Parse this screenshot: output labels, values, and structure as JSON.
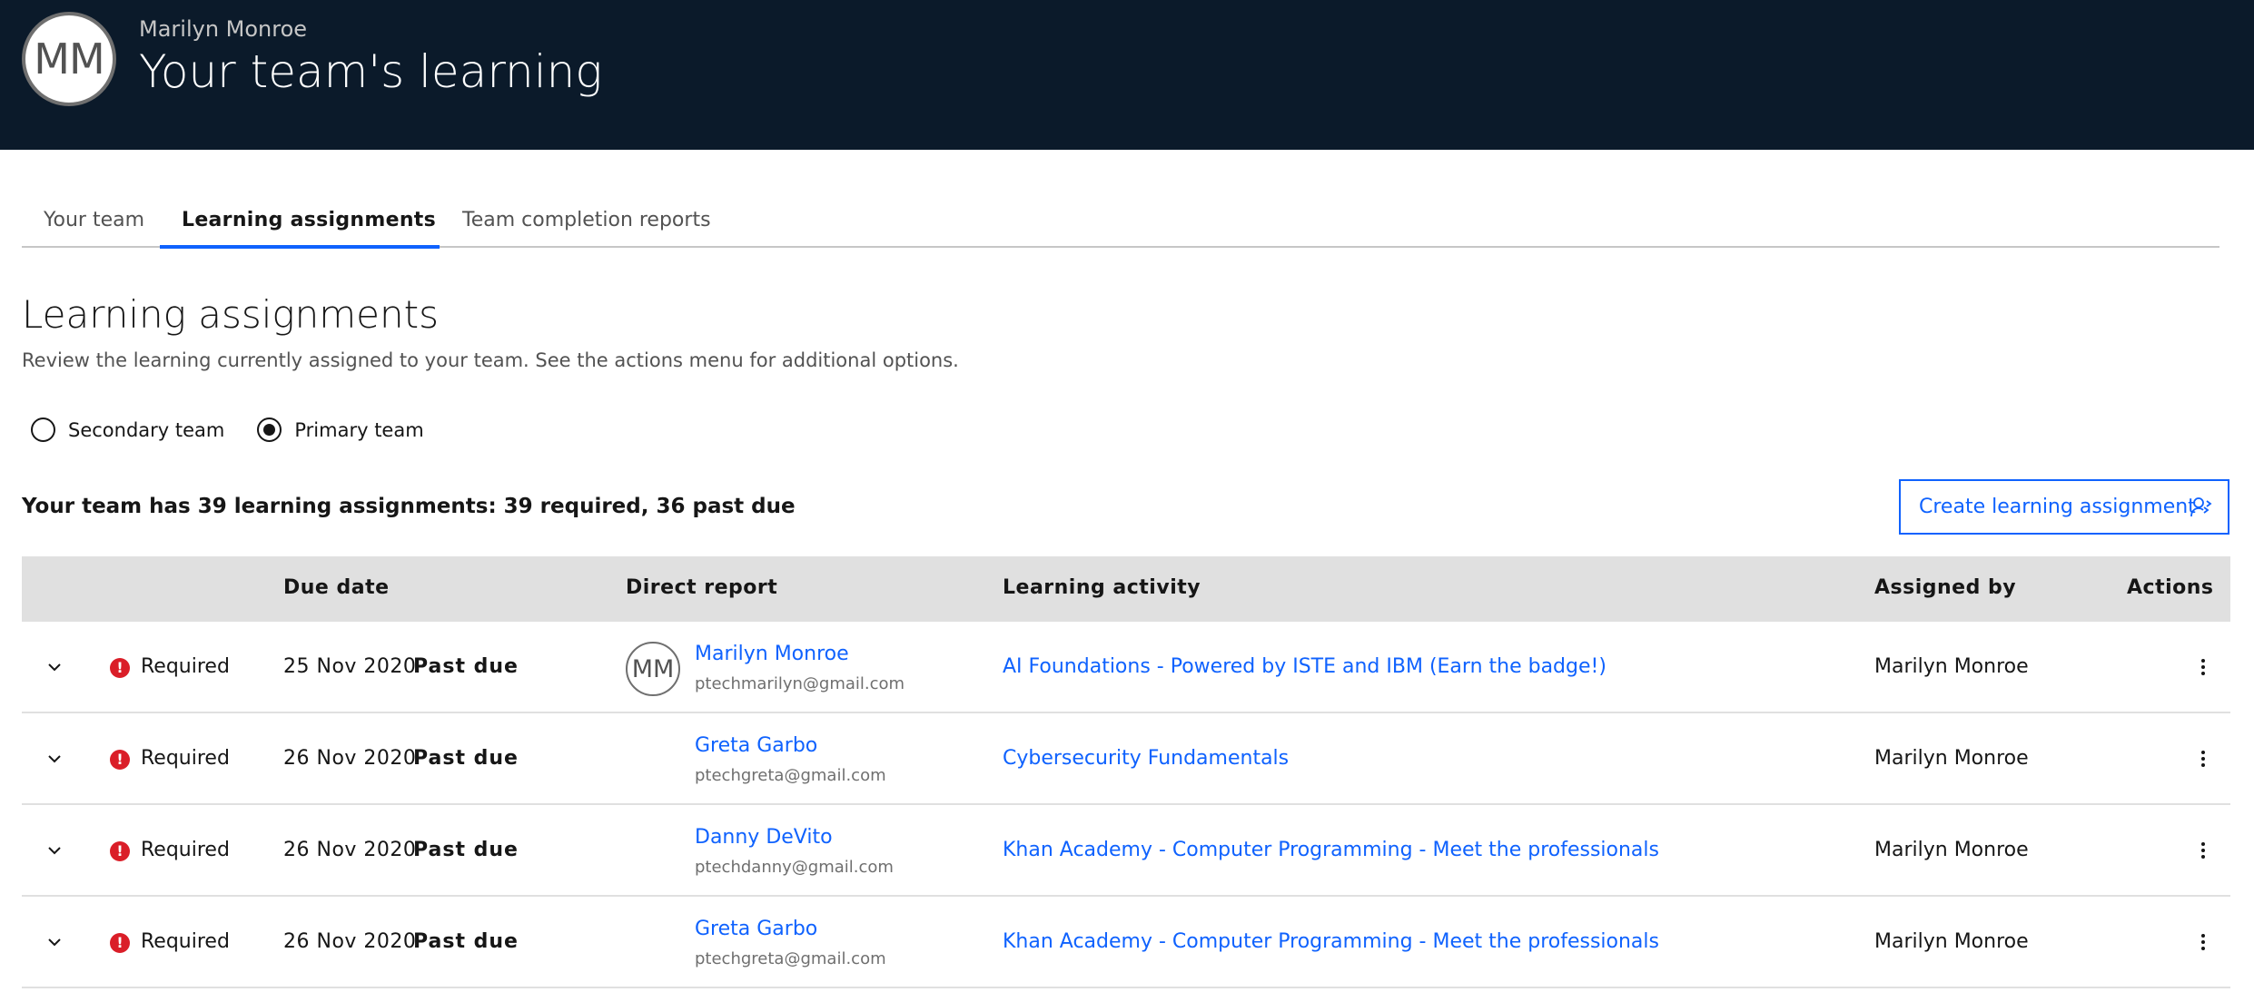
{
  "header": {
    "avatar_initials": "MM",
    "user_name": "Marilyn Monroe",
    "title": "Your team's learning"
  },
  "tabs": [
    {
      "label": "Your team",
      "active": false
    },
    {
      "label": "Learning assignments",
      "active": true
    },
    {
      "label": "Team completion reports",
      "active": false
    }
  ],
  "page": {
    "title": "Learning assignments",
    "description": "Review the learning currently assigned to your team. See the actions menu for additional options."
  },
  "team_filter": {
    "options": [
      {
        "label": "Secondary team",
        "checked": false
      },
      {
        "label": "Primary team",
        "checked": true
      }
    ]
  },
  "summary": "Your team has 39 learning assignments: 39 required, 36 past due",
  "create_button": {
    "label": "Create learning assignment",
    "icon": "user-add-icon"
  },
  "table": {
    "headers": {
      "due_date": "Due date",
      "direct_report": "Direct report",
      "learning_activity": "Learning activity",
      "assigned_by": "Assigned by",
      "actions": "Actions"
    },
    "rows": [
      {
        "requirement": "Required",
        "due_date": "25 Nov 2020",
        "status": "Past due",
        "avatar": "MM",
        "name": "Marilyn Monroe",
        "email": "ptechmarilyn@gmail.com",
        "activity": "AI Foundations - Powered by ISTE and IBM (Earn the badge!)",
        "assigned_by": "Marilyn Monroe"
      },
      {
        "requirement": "Required",
        "due_date": "26 Nov 2020",
        "status": "Past due",
        "avatar": "",
        "name": "Greta Garbo",
        "email": "ptechgreta@gmail.com",
        "activity": "Cybersecurity Fundamentals",
        "assigned_by": "Marilyn Monroe"
      },
      {
        "requirement": "Required",
        "due_date": "26 Nov 2020",
        "status": "Past due",
        "avatar": "",
        "name": "Danny DeVito",
        "email": "ptechdanny@gmail.com",
        "activity": "Khan Academy - Computer Programming - Meet the professionals",
        "assigned_by": "Marilyn Monroe"
      },
      {
        "requirement": "Required",
        "due_date": "26 Nov 2020",
        "status": "Past due",
        "avatar": "",
        "name": "Greta Garbo",
        "email": "ptechgreta@gmail.com",
        "activity": "Khan Academy - Computer Programming - Meet the professionals",
        "assigned_by": "Marilyn Monroe"
      }
    ]
  },
  "colors": {
    "header_bg": "#0b1a2a",
    "accent": "#0f62fe",
    "error": "#da1e28",
    "table_header_bg": "#e0e0e0"
  }
}
